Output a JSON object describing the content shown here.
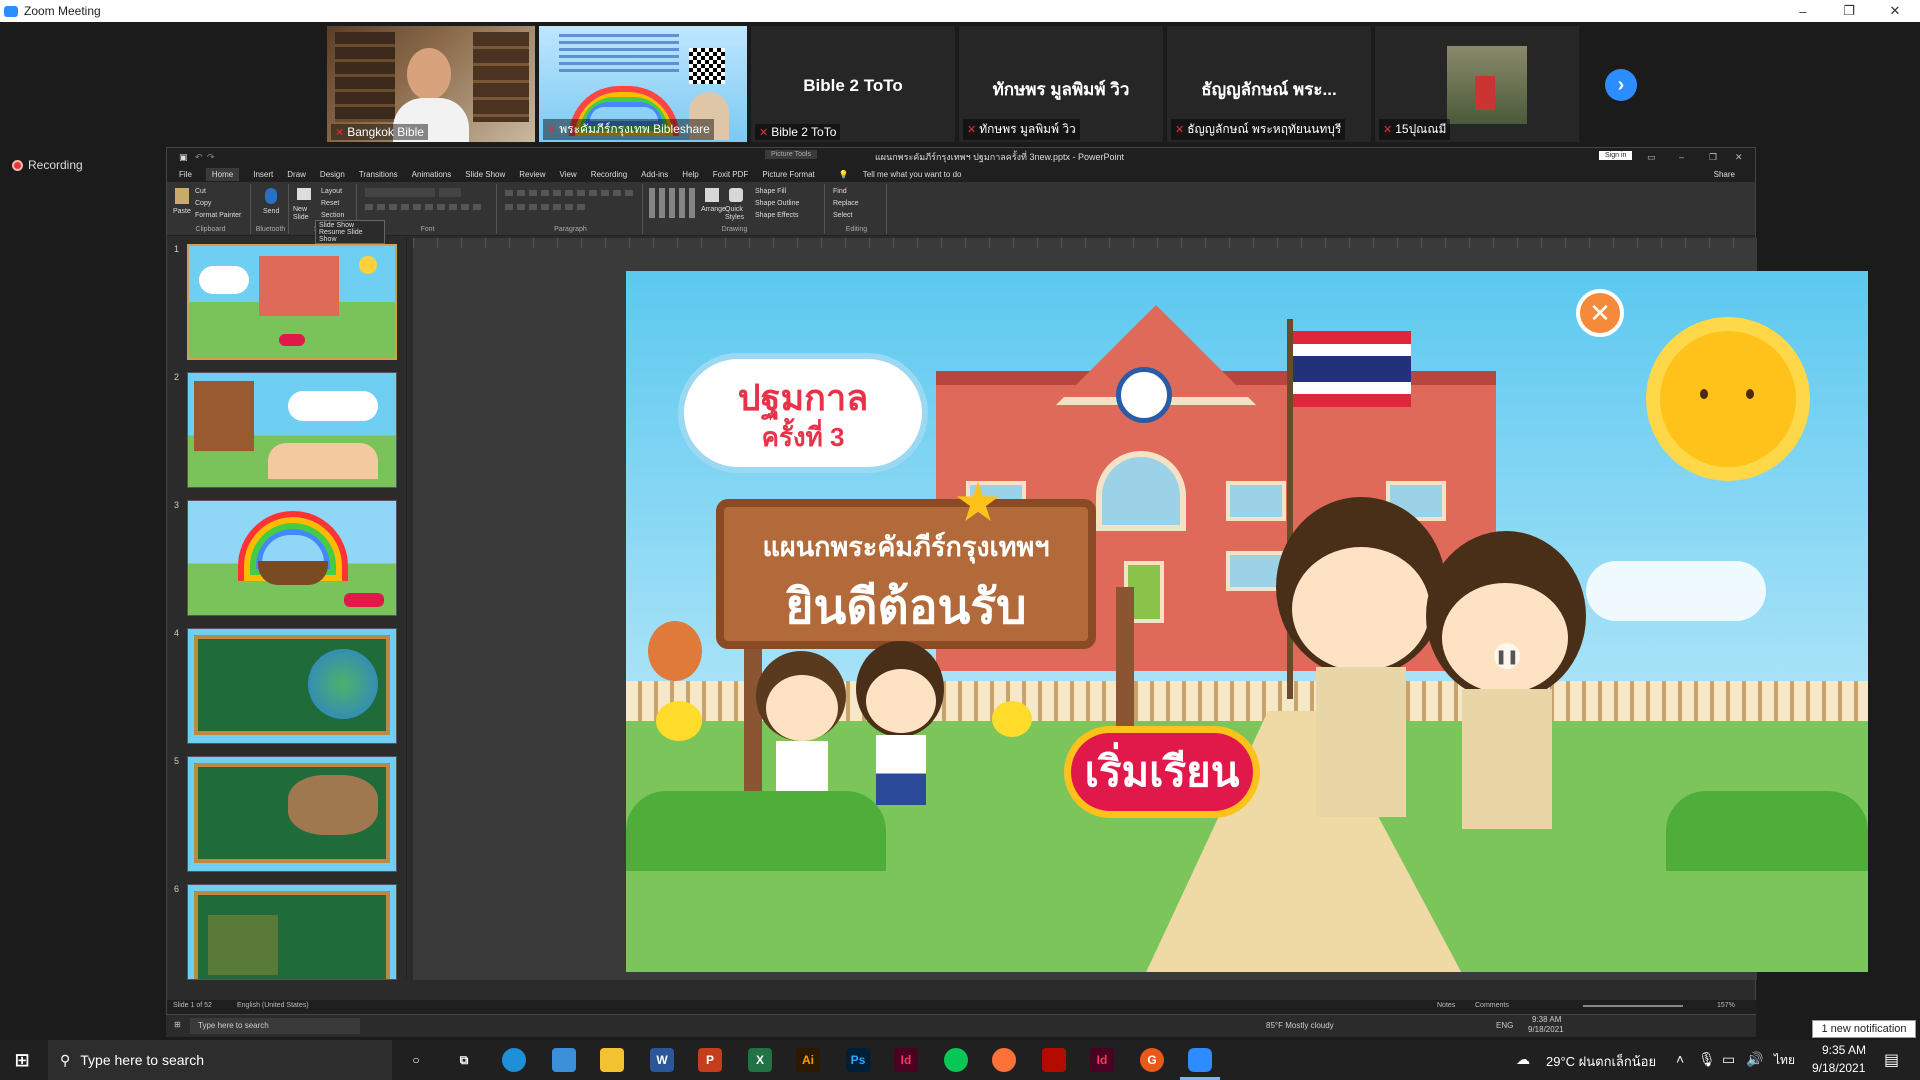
{
  "window": {
    "title": "Zoom Meeting",
    "controls": [
      "–",
      "❐",
      "✕"
    ]
  },
  "participants": [
    {
      "label": "Bangkok Bible",
      "type": "video"
    },
    {
      "label": "พระคัมภีร์กรุงเทพ Bibleshare",
      "type": "video"
    },
    {
      "name": "Bible 2 ToTo",
      "label": "Bible 2 ToTo",
      "type": "name"
    },
    {
      "name": "ทักษพร มูลพิมพ์ วิว",
      "label": "ทักษพร มูลพิมพ์ วิว",
      "type": "name"
    },
    {
      "name": "ธัญญลักษณ์ พระ...",
      "label": "ธัญญลักษณ์ พระหฤทัยนนทบุรี",
      "type": "name"
    },
    {
      "label": "15ปุณณมี",
      "type": "photo"
    }
  ],
  "recording": {
    "label": "Recording"
  },
  "powerpoint": {
    "file_title": "แผนกพระคัมภีร์กรุงเทพฯ ปฐมกาลครั้งที่ 3new.pptx - PowerPoint",
    "context_tab": "Picture Tools",
    "sign_in": "Sign in",
    "share": "Share",
    "tell_me": "Tell me what you want to do",
    "tabs": [
      "File",
      "Home",
      "Insert",
      "Draw",
      "Design",
      "Transitions",
      "Animations",
      "Slide Show",
      "Review",
      "View",
      "Recording",
      "Add-ins",
      "Help",
      "Foxit PDF",
      "Picture Format"
    ],
    "active_tab": "Home",
    "ribbon": {
      "clipboard": {
        "paste": "Paste",
        "cut": "Cut",
        "copy": "Copy",
        "format_painter": "Format Painter",
        "label": "Clipboard"
      },
      "bluetooth": {
        "send": "Send",
        "label": "Bluetooth"
      },
      "slides": {
        "new_slide": "New Slide",
        "layout": "Layout",
        "reset": "Reset",
        "section": "Section",
        "label": "Slides"
      },
      "font": {
        "label": "Font"
      },
      "paragraph": {
        "label": "Paragraph"
      },
      "drawing": {
        "arrange": "Arrange",
        "quick_styles": "Quick Styles",
        "shape_fill": "Shape Fill",
        "shape_outline": "Shape Outline",
        "shape_effects": "Shape Effects",
        "label": "Drawing"
      },
      "editing": {
        "find": "Find",
        "replace": "Replace",
        "select": "Select",
        "label": "Editing"
      },
      "slideshow_tooltip": {
        "title": "Slide Show",
        "item": "Resume Slide Show"
      }
    },
    "slide_numbers": [
      "1",
      "2",
      "3",
      "4",
      "5",
      "6"
    ],
    "status": {
      "slide": "Slide 1 of 52",
      "language": "English (United States)",
      "notes": "Notes",
      "comments": "Comments",
      "zoom": "157%"
    }
  },
  "slide": {
    "title_line1": "ปฐมกาล",
    "title_line2": "ครั้งที่ 3",
    "sign_line1": "แผนกพระคัมภีร์กรุงเทพฯ",
    "sign_line2": "ยินดีต้อนรับ",
    "start_button": "เริ่มเรียน",
    "close_symbol": "✕"
  },
  "remote_taskbar": {
    "search": "Type here to search",
    "weather": "85°F Mostly cloudy",
    "lang": "ENG",
    "time": "9:38 AM",
    "date": "9/18/2021"
  },
  "taskbar": {
    "search": "Type here to search",
    "weather": "29°C ฝนตกเล็กน้อย",
    "lang": "ไทย",
    "time": "9:35 AM",
    "date": "9/18/2021",
    "notification": "1 new notification",
    "apps": [
      "Ai",
      "Ps",
      "Id",
      "Id"
    ]
  },
  "colors": {
    "zoom_blue": "#2d8cff",
    "recording_red": "#e53935",
    "slide_sky": "#5cc8ef",
    "start_button": "#e0194a",
    "sign_wood": "#b36a3a"
  }
}
